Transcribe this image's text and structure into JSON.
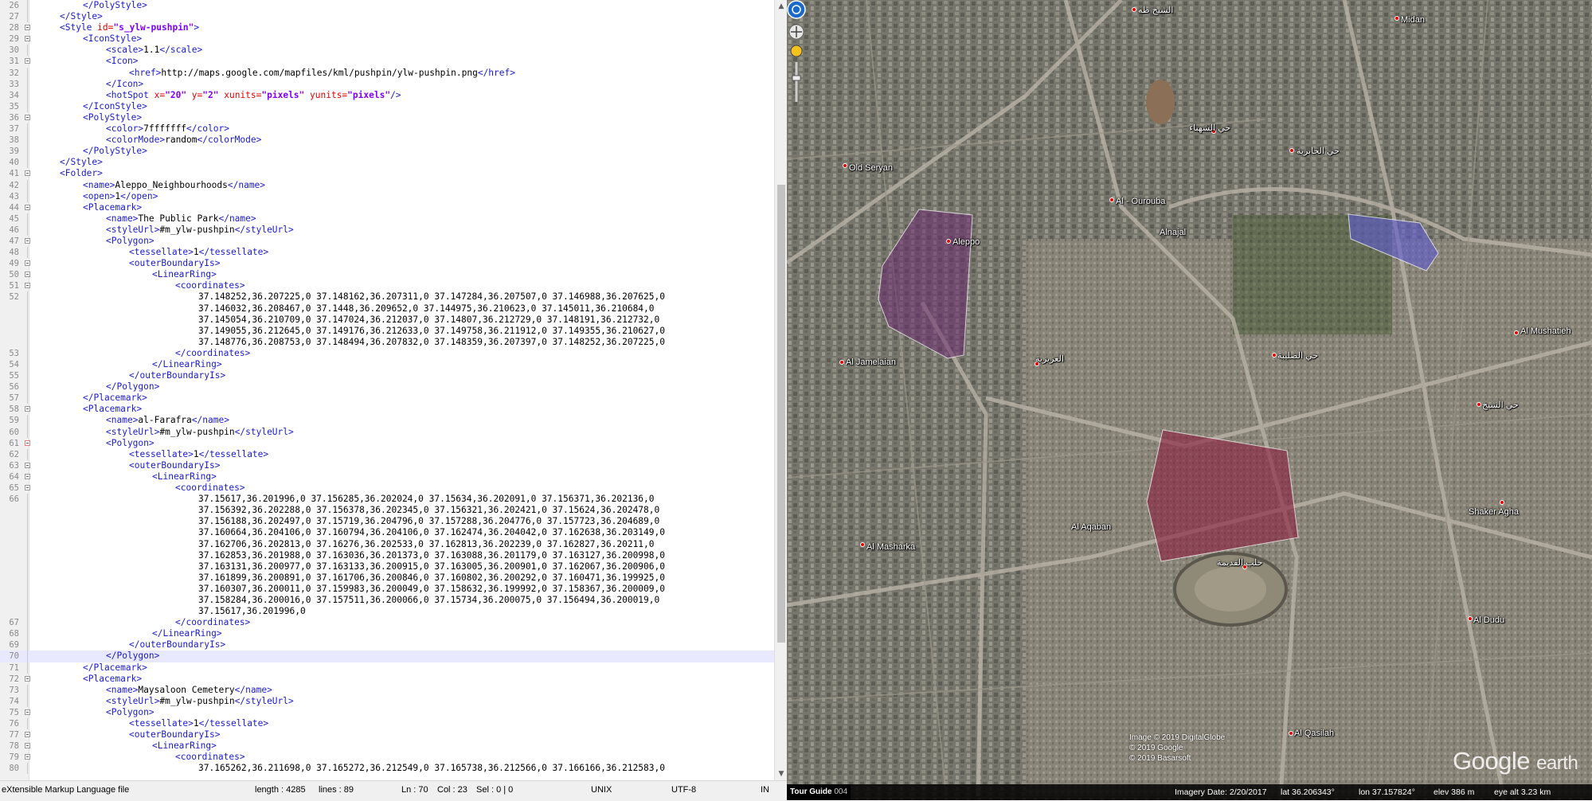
{
  "editor": {
    "lines": [
      {
        "n": "26",
        "indent": 2,
        "parts": [
          [
            "tg",
            "</PolyStyle>"
          ]
        ]
      },
      {
        "n": "27",
        "indent": 1,
        "parts": [
          [
            "tg",
            "</Style>"
          ]
        ]
      },
      {
        "n": "28",
        "indent": 1,
        "fold": true,
        "parts": [
          [
            "tg",
            "<Style "
          ],
          [
            "at",
            "id="
          ],
          [
            "av",
            "\"s_ylw-pushpin\""
          ],
          [
            "tg",
            ">"
          ]
        ]
      },
      {
        "n": "29",
        "indent": 2,
        "fold": true,
        "parts": [
          [
            "tg",
            "<IconStyle>"
          ]
        ]
      },
      {
        "n": "30",
        "indent": 3,
        "parts": [
          [
            "tg",
            "<scale>"
          ],
          [
            "tx",
            "1.1"
          ],
          [
            "tg",
            "</scale>"
          ]
        ]
      },
      {
        "n": "31",
        "indent": 3,
        "fold": true,
        "parts": [
          [
            "tg",
            "<Icon>"
          ]
        ]
      },
      {
        "n": "32",
        "indent": 4,
        "parts": [
          [
            "tg",
            "<href>"
          ],
          [
            "tx",
            "http://maps.google.com/mapfiles/kml/pushpin/ylw-pushpin.png"
          ],
          [
            "tg",
            "</href>"
          ]
        ]
      },
      {
        "n": "33",
        "indent": 3,
        "parts": [
          [
            "tg",
            "</Icon>"
          ]
        ]
      },
      {
        "n": "34",
        "indent": 3,
        "parts": [
          [
            "tg",
            "<hotSpot "
          ],
          [
            "at",
            "x="
          ],
          [
            "av",
            "\"20\""
          ],
          [
            "at",
            " y="
          ],
          [
            "av",
            "\"2\""
          ],
          [
            "at",
            " xunits="
          ],
          [
            "av",
            "\"pixels\""
          ],
          [
            "at",
            " yunits="
          ],
          [
            "av",
            "\"pixels\""
          ],
          [
            "tg",
            "/>"
          ]
        ]
      },
      {
        "n": "35",
        "indent": 2,
        "parts": [
          [
            "tg",
            "</IconStyle>"
          ]
        ]
      },
      {
        "n": "36",
        "indent": 2,
        "fold": true,
        "parts": [
          [
            "tg",
            "<PolyStyle>"
          ]
        ]
      },
      {
        "n": "37",
        "indent": 3,
        "parts": [
          [
            "tg",
            "<color>"
          ],
          [
            "tx",
            "7fffffff"
          ],
          [
            "tg",
            "</color>"
          ]
        ]
      },
      {
        "n": "38",
        "indent": 3,
        "parts": [
          [
            "tg",
            "<colorMode>"
          ],
          [
            "tx",
            "random"
          ],
          [
            "tg",
            "</colorMode>"
          ]
        ]
      },
      {
        "n": "39",
        "indent": 2,
        "parts": [
          [
            "tg",
            "</PolyStyle>"
          ]
        ]
      },
      {
        "n": "40",
        "indent": 1,
        "parts": [
          [
            "tg",
            "</Style>"
          ]
        ]
      },
      {
        "n": "41",
        "indent": 1,
        "fold": true,
        "parts": [
          [
            "tg",
            "<Folder>"
          ]
        ]
      },
      {
        "n": "42",
        "indent": 2,
        "parts": [
          [
            "tg",
            "<name>"
          ],
          [
            "tx",
            "Aleppo_Neighbourhoods"
          ],
          [
            "tg",
            "</name>"
          ]
        ]
      },
      {
        "n": "43",
        "indent": 2,
        "parts": [
          [
            "tg",
            "<open>"
          ],
          [
            "tx",
            "1"
          ],
          [
            "tg",
            "</open>"
          ]
        ]
      },
      {
        "n": "44",
        "indent": 2,
        "fold": true,
        "parts": [
          [
            "tg",
            "<Placemark>"
          ]
        ]
      },
      {
        "n": "45",
        "indent": 3,
        "parts": [
          [
            "tg",
            "<name>"
          ],
          [
            "tx",
            "The Public Park"
          ],
          [
            "tg",
            "</name>"
          ]
        ]
      },
      {
        "n": "46",
        "indent": 3,
        "parts": [
          [
            "tg",
            "<styleUrl>"
          ],
          [
            "tx",
            "#m_ylw-pushpin"
          ],
          [
            "tg",
            "</styleUrl>"
          ]
        ]
      },
      {
        "n": "47",
        "indent": 3,
        "fold": true,
        "parts": [
          [
            "tg",
            "<Polygon>"
          ]
        ]
      },
      {
        "n": "48",
        "indent": 4,
        "parts": [
          [
            "tg",
            "<tessellate>"
          ],
          [
            "tx",
            "1"
          ],
          [
            "tg",
            "</tessellate>"
          ]
        ]
      },
      {
        "n": "49",
        "indent": 4,
        "fold": true,
        "parts": [
          [
            "tg",
            "<outerBoundaryIs>"
          ]
        ]
      },
      {
        "n": "50",
        "indent": 5,
        "fold": true,
        "parts": [
          [
            "tg",
            "<LinearRing>"
          ]
        ]
      },
      {
        "n": "51",
        "indent": 6,
        "fold": true,
        "parts": [
          [
            "tg",
            "<coordinates>"
          ]
        ]
      },
      {
        "n": "52",
        "indent": 7,
        "parts": [
          [
            "tx",
            "37.148252,36.207225,0 37.148162,36.207311,0 37.147284,36.207507,0 37.146988,36.207625,0"
          ]
        ]
      },
      {
        "n": "",
        "indent": 7,
        "parts": [
          [
            "tx",
            "37.146032,36.208467,0 37.1448,36.209652,0 37.144975,36.210623,0 37.145011,36.210684,0"
          ]
        ]
      },
      {
        "n": "",
        "indent": 7,
        "parts": [
          [
            "tx",
            "37.145054,36.210709,0 37.147024,36.212037,0 37.14807,36.212729,0 37.148191,36.212732,0"
          ]
        ]
      },
      {
        "n": "",
        "indent": 7,
        "parts": [
          [
            "tx",
            "37.149055,36.212645,0 37.149176,36.212633,0 37.149758,36.211912,0 37.149355,36.210627,0"
          ]
        ]
      },
      {
        "n": "",
        "indent": 7,
        "parts": [
          [
            "tx",
            "37.148776,36.208753,0 37.148494,36.207832,0 37.148359,36.207397,0 37.148252,36.207225,0"
          ]
        ]
      },
      {
        "n": "53",
        "indent": 6,
        "parts": [
          [
            "tg",
            "</coordinates>"
          ]
        ]
      },
      {
        "n": "54",
        "indent": 5,
        "parts": [
          [
            "tg",
            "</LinearRing>"
          ]
        ]
      },
      {
        "n": "55",
        "indent": 4,
        "parts": [
          [
            "tg",
            "</outerBoundaryIs>"
          ]
        ]
      },
      {
        "n": "56",
        "indent": 3,
        "parts": [
          [
            "tg",
            "</Polygon>"
          ]
        ]
      },
      {
        "n": "57",
        "indent": 2,
        "parts": [
          [
            "tg",
            "</Placemark>"
          ]
        ]
      },
      {
        "n": "58",
        "indent": 2,
        "fold": true,
        "parts": [
          [
            "tg",
            "<Placemark>"
          ]
        ]
      },
      {
        "n": "59",
        "indent": 3,
        "parts": [
          [
            "tg",
            "<name>"
          ],
          [
            "tx",
            "al-Farafra"
          ],
          [
            "tg",
            "</name>"
          ]
        ]
      },
      {
        "n": "60",
        "indent": 3,
        "parts": [
          [
            "tg",
            "<styleUrl>"
          ],
          [
            "tx",
            "#m_ylw-pushpin"
          ],
          [
            "tg",
            "</styleUrl>"
          ]
        ]
      },
      {
        "n": "61",
        "indent": 3,
        "fold": true,
        "red": true,
        "parts": [
          [
            "tg",
            "<Polygon>"
          ]
        ]
      },
      {
        "n": "62",
        "indent": 4,
        "parts": [
          [
            "tg",
            "<tessellate>"
          ],
          [
            "tx",
            "1"
          ],
          [
            "tg",
            "</tessellate>"
          ]
        ]
      },
      {
        "n": "63",
        "indent": 4,
        "fold": true,
        "parts": [
          [
            "tg",
            "<outerBoundaryIs>"
          ]
        ]
      },
      {
        "n": "64",
        "indent": 5,
        "fold": true,
        "parts": [
          [
            "tg",
            "<LinearRing>"
          ]
        ]
      },
      {
        "n": "65",
        "indent": 6,
        "fold": true,
        "parts": [
          [
            "tg",
            "<coordinates>"
          ]
        ]
      },
      {
        "n": "66",
        "indent": 7,
        "parts": [
          [
            "tx",
            "37.15617,36.201996,0 37.156285,36.202024,0 37.15634,36.202091,0 37.156371,36.202136,0"
          ]
        ]
      },
      {
        "n": "",
        "indent": 7,
        "parts": [
          [
            "tx",
            "37.156392,36.202288,0 37.156378,36.202345,0 37.156321,36.202421,0 37.15624,36.202478,0"
          ]
        ]
      },
      {
        "n": "",
        "indent": 7,
        "parts": [
          [
            "tx",
            "37.156188,36.202497,0 37.15719,36.204796,0 37.157288,36.204776,0 37.157723,36.204689,0"
          ]
        ]
      },
      {
        "n": "",
        "indent": 7,
        "parts": [
          [
            "tx",
            "37.160664,36.204106,0 37.160794,36.204106,0 37.162474,36.204042,0 37.162638,36.203149,0"
          ]
        ]
      },
      {
        "n": "",
        "indent": 7,
        "parts": [
          [
            "tx",
            "37.162706,36.202813,0 37.16276,36.202533,0 37.162813,36.202239,0 37.162827,36.20211,0"
          ]
        ]
      },
      {
        "n": "",
        "indent": 7,
        "parts": [
          [
            "tx",
            "37.162853,36.201988,0 37.163036,36.201373,0 37.163088,36.201179,0 37.163127,36.200998,0"
          ]
        ]
      },
      {
        "n": "",
        "indent": 7,
        "parts": [
          [
            "tx",
            "37.163131,36.200977,0 37.163133,36.200915,0 37.163005,36.200901,0 37.162067,36.200906,0"
          ]
        ]
      },
      {
        "n": "",
        "indent": 7,
        "parts": [
          [
            "tx",
            "37.161899,36.200891,0 37.161706,36.200846,0 37.160802,36.200292,0 37.160471,36.199925,0"
          ]
        ]
      },
      {
        "n": "",
        "indent": 7,
        "parts": [
          [
            "tx",
            "37.160307,36.200011,0 37.159983,36.200049,0 37.158632,36.199992,0 37.158367,36.200009,0"
          ]
        ]
      },
      {
        "n": "",
        "indent": 7,
        "parts": [
          [
            "tx",
            "37.158284,36.200016,0 37.157511,36.200066,0 37.15734,36.200075,0 37.156494,36.200019,0"
          ]
        ]
      },
      {
        "n": "",
        "indent": 7,
        "parts": [
          [
            "tx",
            "37.15617,36.201996,0"
          ]
        ]
      },
      {
        "n": "67",
        "indent": 6,
        "parts": [
          [
            "tg",
            "</coordinates>"
          ]
        ]
      },
      {
        "n": "68",
        "indent": 5,
        "parts": [
          [
            "tg",
            "</LinearRing>"
          ]
        ]
      },
      {
        "n": "69",
        "indent": 4,
        "parts": [
          [
            "tg",
            "</outerBoundaryIs>"
          ]
        ]
      },
      {
        "n": "70",
        "indent": 3,
        "current": true,
        "parts": [
          [
            "tg",
            "</Polygon>"
          ]
        ]
      },
      {
        "n": "71",
        "indent": 2,
        "parts": [
          [
            "tg",
            "</Placemark>"
          ]
        ]
      },
      {
        "n": "72",
        "indent": 2,
        "fold": true,
        "parts": [
          [
            "tg",
            "<Placemark>"
          ]
        ]
      },
      {
        "n": "73",
        "indent": 3,
        "parts": [
          [
            "tg",
            "<name>"
          ],
          [
            "tx",
            "Maysaloon Cemetery"
          ],
          [
            "tg",
            "</name>"
          ]
        ]
      },
      {
        "n": "74",
        "indent": 3,
        "parts": [
          [
            "tg",
            "<styleUrl>"
          ],
          [
            "tx",
            "#m_ylw-pushpin"
          ],
          [
            "tg",
            "</styleUrl>"
          ]
        ]
      },
      {
        "n": "75",
        "indent": 3,
        "fold": true,
        "parts": [
          [
            "tg",
            "<Polygon>"
          ]
        ]
      },
      {
        "n": "76",
        "indent": 4,
        "parts": [
          [
            "tg",
            "<tessellate>"
          ],
          [
            "tx",
            "1"
          ],
          [
            "tg",
            "</tessellate>"
          ]
        ]
      },
      {
        "n": "77",
        "indent": 4,
        "fold": true,
        "parts": [
          [
            "tg",
            "<outerBoundaryIs>"
          ]
        ]
      },
      {
        "n": "78",
        "indent": 5,
        "fold": true,
        "parts": [
          [
            "tg",
            "<LinearRing>"
          ]
        ]
      },
      {
        "n": "79",
        "indent": 6,
        "fold": true,
        "parts": [
          [
            "tg",
            "<coordinates>"
          ]
        ]
      },
      {
        "n": "80",
        "indent": 7,
        "parts": [
          [
            "tx",
            "37.165262,36.211698,0 37.165272,36.212549,0 37.165738,36.212566,0 37.166166,36.212583,0"
          ]
        ]
      }
    ]
  },
  "statusbar": {
    "filetype": "eXtensible Markup Language file",
    "length": "length : 4285",
    "lines": "lines : 89",
    "ln": "Ln : 70",
    "col": "Col : 23",
    "sel": "Sel : 0 | 0",
    "eol": "UNIX",
    "encoding": "UTF-8",
    "mode": "IN"
  },
  "earth": {
    "labels": {
      "miidan": "Midan",
      "old_seryan": "Old Seryan",
      "al_ourouba": "Al - Ourouba",
      "aleppo": "Aleppo",
      "alnajal": "Alnajal",
      "al_jamelaian": "Al Jamelaian",
      "al_mushatieh": "Al Mushatieh",
      "al_aqaban": "Al Aqaban",
      "shaker_agha": "Shaker Agha",
      "al_masharka": "Al Masharka",
      "al_dudu": "Al Dudu",
      "al_qasilah": "Al Qasilah",
      "arabic_top": "الشيخ طه",
      "arabic_1": "حي الشهباء",
      "arabic_2": "حي الجابرية",
      "arabic_3": "العزيزية",
      "arabic_4": "حي الصليبة",
      "arabic_5": "حي الشيخ",
      "arabic_6": "حلب القديمة"
    },
    "copyright": [
      "Image © 2019 DigitalGlobe",
      "© 2019 Google",
      "© 2019 Basarsoft"
    ],
    "logo": {
      "word1": "Google",
      "word2": "earth"
    },
    "tour_guide": "Tour Guide",
    "tour_count": "004",
    "status": {
      "imagery": "Imagery Date: 2/20/2017",
      "lat": "lat  36.206343°",
      "lon": "lon  37.157824°",
      "elev": "elev  386 m",
      "eye": "eye alt  3.23 km"
    },
    "colors": {
      "park_polygon": "#6a2a6e",
      "farafra_polygon": "#8a1d3c",
      "cemetery_polygon": "#5e5ad0"
    }
  }
}
